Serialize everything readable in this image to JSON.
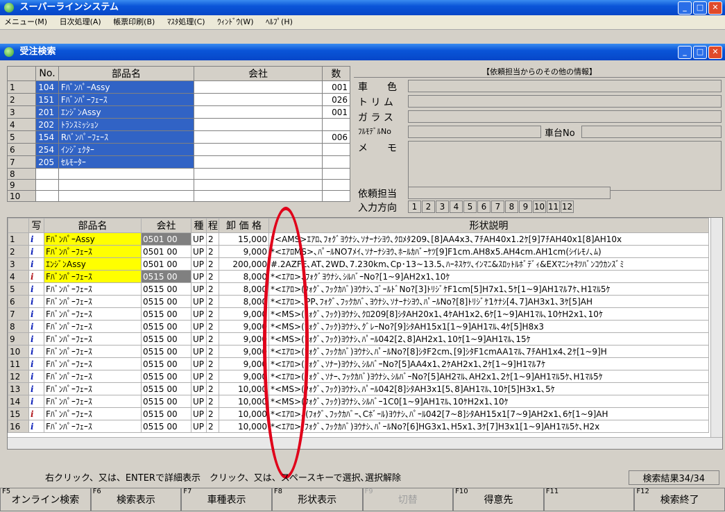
{
  "app": {
    "title": "スーパーラインシステム"
  },
  "menu": [
    "メニュー(M)",
    "日次処理(A)",
    "帳票印刷(B)",
    "ﾏｽﾀ処理(C)",
    "ｳｨﾝﾄﾞｳ(W)",
    "ﾍﾙﾌﾟ(H)"
  ],
  "child": {
    "title": "受注検索"
  },
  "parts_header": {
    "no": "No.",
    "name": "部品名",
    "company": "会社",
    "qty": "数"
  },
  "parts": [
    {
      "row": "1",
      "no": "104",
      "name": "FﾊﾞﾝﾊﾟｰAssy",
      "qty": "001"
    },
    {
      "row": "2",
      "no": "151",
      "name": "Fﾊﾞﾝﾊﾟｰﾌｪｰｽ",
      "qty": "026"
    },
    {
      "row": "3",
      "no": "201",
      "name": "ｴﾝｼﾞﾝAssy",
      "qty": "001"
    },
    {
      "row": "4",
      "no": "202",
      "name": "ﾄﾗﾝｽﾐｯｼｮﾝ",
      "qty": ""
    },
    {
      "row": "5",
      "no": "154",
      "name": "Rﾊﾞﾝﾊﾟｰﾌｪｰｽ",
      "qty": "006"
    },
    {
      "row": "6",
      "no": "254",
      "name": "ｲﾝｼﾞｪｸﾀｰ",
      "qty": ""
    },
    {
      "row": "7",
      "no": "205",
      "name": "ｾﾙﾓｰﾀｰ",
      "qty": ""
    },
    {
      "row": "8",
      "no": "",
      "name": "",
      "qty": ""
    },
    {
      "row": "9",
      "no": "",
      "name": "",
      "qty": ""
    },
    {
      "row": "10",
      "no": "",
      "name": "",
      "qty": ""
    }
  ],
  "info": {
    "header": "【依頼担当からのその他の情報】",
    "color": "車　　色",
    "trim": "ト リ ム",
    "glass": "ガ ラ ス",
    "fullmodel": "ﾌﾙﾓﾃﾞﾙNo",
    "chassis": "車台No",
    "memo": "メ　　モ",
    "requester": "依頼担当",
    "direction": "入力方向",
    "dirs": [
      "1",
      "2",
      "3",
      "4",
      "5",
      "6",
      "7",
      "8",
      "9",
      "10",
      "11",
      "12"
    ]
  },
  "grid_header": {
    "photo": "写",
    "name": "部品名",
    "company": "会社",
    "kind": "種",
    "step": "程",
    "price": "卸 価 格",
    "shape": "形状説明"
  },
  "grid": [
    {
      "row": "1",
      "icon": "i",
      "name": "FﾊﾞﾝﾊﾟｰAssy",
      "company": "0501 00",
      "kind": "UP",
      "step": "2",
      "price": "15,000",
      "desc": "*<AMS>ｴｱﾛ､ﾌｫｸﾞﾖｳﾅｼ､ｿﾅｰﾅｼﾖｳ､ｸﾛﾒﾀ209､[8]AA4x3､7ﾁAH40x1.2ｹ[9]7ﾁAH40x1[8]AH10x"
    },
    {
      "row": "2",
      "icon": "i",
      "name": "Fﾊﾞﾝﾊﾟｰﾌｪｰｽ",
      "company": "0501 00",
      "kind": "UP",
      "step": "2",
      "price": "9,000",
      "desc": "*<ｴｱﾛMS>､ﾊﾟｰﾙNO7ﾒｲ､ｿﾅｰﾅｼﾖｳ､ﾎｰﾙｶﾊﾞｰｹﾂ[9]F1cm.AH8x5.AH4cm.AH1cm(ｼｲﾚﾓﾉ､ﾑ)"
    },
    {
      "row": "3",
      "icon": "i",
      "name": "ｴﾝｼﾞﾝAssy",
      "company": "0501 00",
      "kind": "UP",
      "step": "2",
      "price": "200,000",
      "desc": "#.2AZFE､AT､2WD､7.230km､Cp･13~13.5､ﾊｰﾈｽｹﾂ､ｲﾝﾏﾆ&ｽﾛｯﾄﾙﾎﾞﾃﾞｨ&EXﾏﾆｼｬﾈﾂﾊﾞﾝｺｳｶﾝｽﾞﾐ"
    },
    {
      "row": "4",
      "icon": "ii",
      "name": "Fﾊﾞﾝﾊﾟｰﾌｪｰｽ",
      "company": "0515 00",
      "kind": "UP",
      "step": "2",
      "price": "8,000",
      "desc": "*<ｴｱﾛ>､ﾌｫｸﾞﾖｳﾅｼ､ｼﾙﾊﾞｰNo?[1~9]AH2x1､10ｹ"
    },
    {
      "row": "5",
      "icon": "i",
      "name": "Fﾊﾞﾝﾊﾟｰﾌｪｰｽ",
      "company": "0515 00",
      "kind": "UP",
      "step": "2",
      "price": "8,000",
      "desc": "*<ｴｱﾛ>(ﾌｫｸﾞ､ﾌｯｸｶﾊﾞ)ﾖｳﾅｼ､ｺﾞｰﾙﾄﾞNo?[3]ﾄﾘｼﾞｹF1cm[5]H7x1､5ｹ[1~9]AH1ﾏﾙ7ｹ､H1ﾏﾙ5ｹ"
    },
    {
      "row": "6",
      "icon": "i",
      "name": "Fﾊﾞﾝﾊﾟｰﾌｪｰｽ",
      "company": "0515 00",
      "kind": "UP",
      "step": "2",
      "price": "8,000",
      "desc": "*<ｴｱﾛ>､PP､ﾌｫｸﾞ､ﾌｯｸｶﾊﾞ､ﾖｳﾅｼ､ｿﾅｰﾅｼﾖｳ､ﾊﾟｰﾙNo?[8]ﾄﾘｼﾞｹ1ｹﾅｼ[4､7]AH3x1､3ｹ[5]AH"
    },
    {
      "row": "7",
      "icon": "i",
      "name": "Fﾊﾞﾝﾊﾟｰﾌｪｰｽ",
      "company": "0515 00",
      "kind": "UP",
      "step": "2",
      "price": "9,000",
      "desc": "*<MS>(ﾌｫｸﾞ､ﾌｯｸ)ﾖｳﾅｼ､ｸﾛ209[8]ｼﾀAH20x1､4ｹAH1x2､6ｹ[1~9]AH1ﾏﾙ､10ｹH2x1､10ｹ"
    },
    {
      "row": "8",
      "icon": "i",
      "name": "Fﾊﾞﾝﾊﾟｰﾌｪｰｽ",
      "company": "0515 00",
      "kind": "UP",
      "step": "2",
      "price": "9,000",
      "desc": "*<MS>(ﾌｫｸﾞ､ﾌｯｸ)ﾖｳﾅｼ､ｸﾞﾚｰNo?[9]ｼﾀAH15x1[1~9]AH1ﾏﾙ､4ｹ[5]H8x3"
    },
    {
      "row": "9",
      "icon": "i",
      "name": "Fﾊﾞﾝﾊﾟｰﾌｪｰｽ",
      "company": "0515 00",
      "kind": "UP",
      "step": "2",
      "price": "9,000",
      "desc": "*<MS>(ﾌｫｸﾞ､ﾌｯｸ)ﾖｳﾅｼ､ﾊﾟｰﾙ042[2､8]AH2x1､10ｹ[1~9]AH1ﾏﾙ､15ｹ"
    },
    {
      "row": "10",
      "icon": "i",
      "name": "Fﾊﾞﾝﾊﾟｰﾌｪｰｽ",
      "company": "0515 00",
      "kind": "UP",
      "step": "2",
      "price": "9,000",
      "desc": "*<ｴｱﾛ>(ﾌｫｸﾞ､ﾌｯｸｶﾊﾞ)ﾖｳﾅｼ､ﾊﾟｰﾙNo?[8]ｼﾀF2cm､[9]ｼﾀF1cmAA1ﾏﾙ､7ﾁAH1x4､2ｹ[1~9]H"
    },
    {
      "row": "11",
      "icon": "i",
      "name": "Fﾊﾞﾝﾊﾟｰﾌｪｰｽ",
      "company": "0515 00",
      "kind": "UP",
      "step": "2",
      "price": "9,000",
      "desc": "*<ｴｱﾛ>(ﾌｫｸﾞ､ｿﾅｰ)ﾖｳﾅｼ､ｼﾙﾊﾞｰNo?[5]AA4x1､2ｹAH2x1､2ｹ[1~9]H1ﾏﾙ7ｹ"
    },
    {
      "row": "12",
      "icon": "i",
      "name": "Fﾊﾞﾝﾊﾟｰﾌｪｰｽ",
      "company": "0515 00",
      "kind": "UP",
      "step": "2",
      "price": "9,000",
      "desc": "*<ｴｱﾛ>(ﾌｫｸﾞ､ｿﾅｰ､ﾌｯｸｶﾊﾞ)ﾖｳﾅｼ､ｼﾙﾊﾞｰNo?[5]AH2ﾏﾙ､AH2x1､2ｹ[1~9]AH1ﾏﾙ5ｹ､H1ﾏﾙ5ｹ"
    },
    {
      "row": "13",
      "icon": "i",
      "name": "Fﾊﾞﾝﾊﾟｰﾌｪｰｽ",
      "company": "0515 00",
      "kind": "UP",
      "step": "2",
      "price": "10,000",
      "desc": "*<MS>(ﾌｫｸﾞ､ﾌｯｸ)ﾖｳﾅｼ､ﾊﾟｰﾙ042[8]ｼﾀAH3x1[5､8]AH1ﾏﾙ､10ｹ[5]H3x1､5ｹ"
    },
    {
      "row": "14",
      "icon": "i",
      "name": "Fﾊﾞﾝﾊﾟｰﾌｪｰｽ",
      "company": "0515 00",
      "kind": "UP",
      "step": "2",
      "price": "10,000",
      "desc": "*<MS>(ﾌｫｸﾞ､ﾌｯｸ)ﾖｳﾅｼ､ｼﾙﾊﾞｰ1C0[1~9]AH1ﾏﾙ､10ｹH2x1､10ｹ"
    },
    {
      "row": "15",
      "icon": "ii",
      "name": "Fﾊﾞﾝﾊﾟｰﾌｪｰｽ",
      "company": "0515 00",
      "kind": "UP",
      "step": "2",
      "price": "10,000",
      "desc": "*<ｴｱﾛ>､(ﾌｫｸﾞ､ﾌｯｸｶﾊﾞｰ､Cﾎﾞｰﾙ)ﾖｳﾅｼ､ﾊﾟｰﾙ042[7~8]ｼﾀAH15x1[7~9]AH2x1､6ｹ[1~9]AH"
    },
    {
      "row": "16",
      "icon": "i",
      "name": "Fﾊﾞﾝﾊﾟｰﾌｪｰｽ",
      "company": "0515 00",
      "kind": "UP",
      "step": "2",
      "price": "10,000",
      "desc": "*<ｴｱﾛ>(ﾌｫｸﾞ､ﾌｯｸｶﾊﾞ)ﾖｳﾅｼ､ﾊﾟｰﾙNo?[6]HG3x1､H5x1､3ｹ[7]H3x1[1~9]AH1ﾏﾙ5ｹ､H2x"
    }
  ],
  "status": {
    "hint": "右クリック、又は、ENTERで詳細表示　クリック、又は、スペースキーで選択､選択解除",
    "result": "検索結果34/34"
  },
  "fkeys": [
    {
      "key": "F5",
      "label": "オンライン検索"
    },
    {
      "key": "F6",
      "label": "検索表示"
    },
    {
      "key": "F7",
      "label": "車種表示"
    },
    {
      "key": "F8",
      "label": "形状表示"
    },
    {
      "key": "F9",
      "label": "切替"
    },
    {
      "key": "F10",
      "label": "得意先"
    },
    {
      "key": "F11",
      "label": ""
    },
    {
      "key": "F12",
      "label": "検索終了"
    }
  ]
}
